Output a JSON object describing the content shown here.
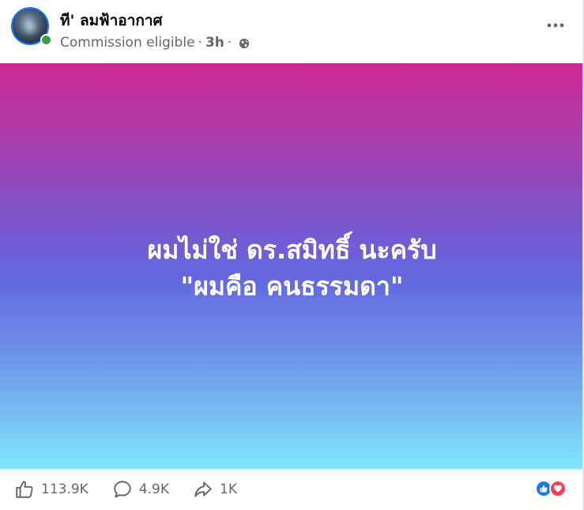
{
  "post": {
    "author": "ที' ลมฟ้าอากาศ",
    "meta_label": "Commission eligible",
    "separator": "·",
    "time": "3h",
    "audience_icon": "globe-icon",
    "more_icon": "more-horizontal-icon",
    "online": true
  },
  "banner": {
    "line1": "ผมไม่ใช่ ดร.สมิทธิ์ นะครับ",
    "line2": "\"ผมคือ คนธรรมดา\"",
    "gradient_top": "#cc2a93",
    "gradient_mid": "#6366de",
    "gradient_bottom": "#7fe8fb"
  },
  "actions": {
    "likes": "113.9K",
    "comments": "4.9K",
    "shares": "1K"
  },
  "reactions": [
    "like-reaction-icon",
    "love-reaction-icon"
  ],
  "colors": {
    "brand_blue": "#1877f2",
    "love_red": "#f33e58",
    "online_green": "#31a24c",
    "secondary_text": "#65676b"
  }
}
